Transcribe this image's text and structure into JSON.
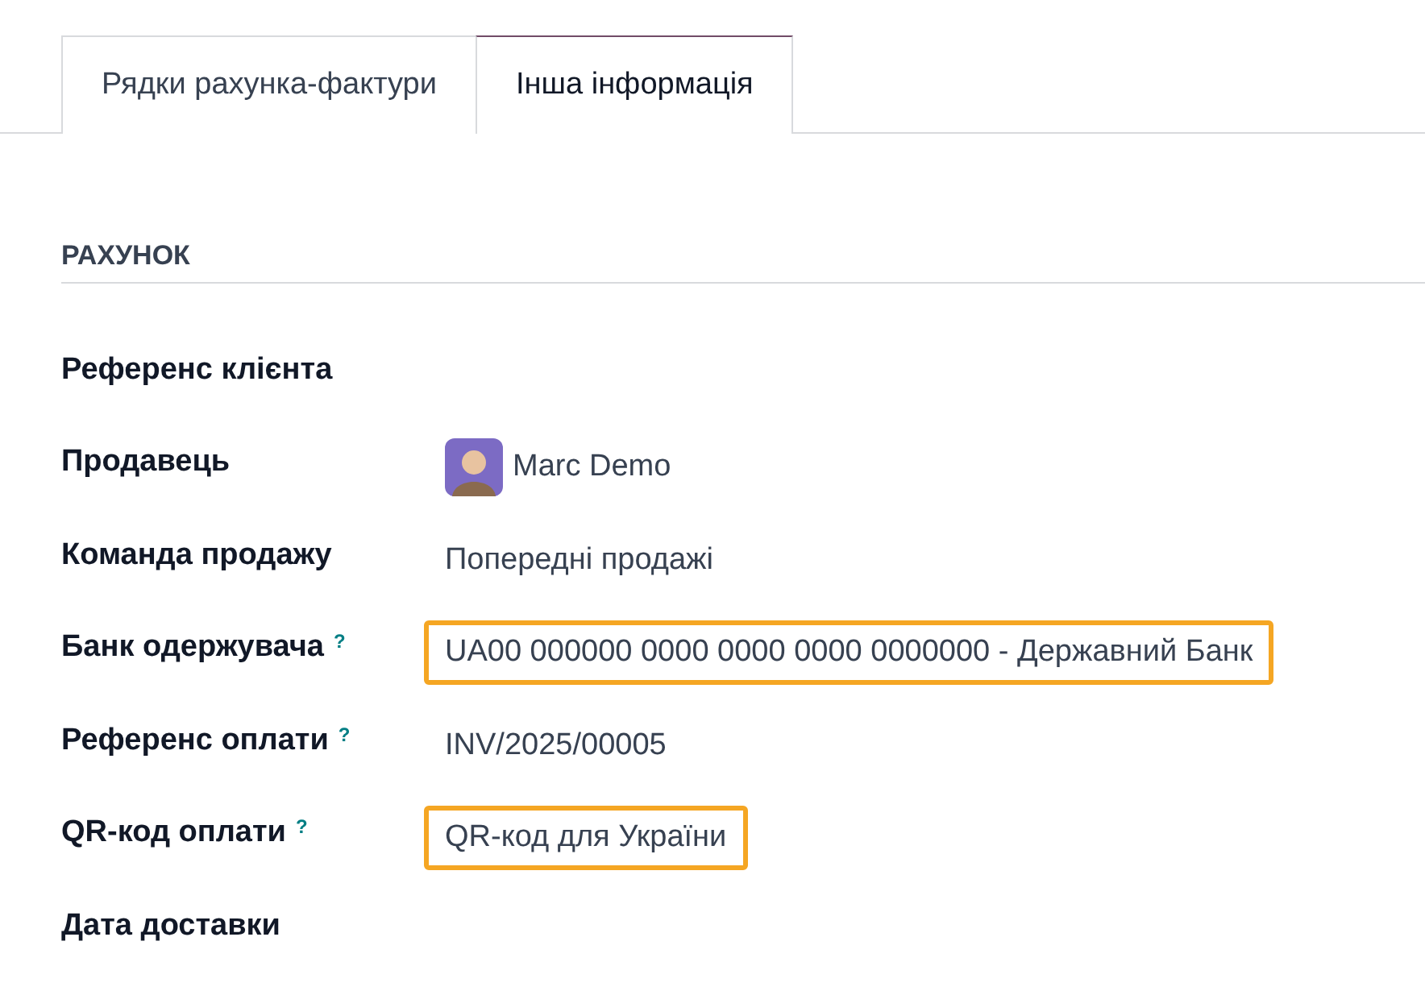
{
  "tabs": [
    {
      "label": "Рядки рахунка-фактури",
      "selected": false
    },
    {
      "label": "Інша інформація",
      "selected": true
    }
  ],
  "section": {
    "title": "РАХУНОК"
  },
  "fields": [
    {
      "kind": "empty",
      "label": "Референс клієнта"
    },
    {
      "kind": "user",
      "label": "Продавець",
      "value": "Marc Demo"
    },
    {
      "kind": "text",
      "label": "Команда продажу",
      "value": "Попередні продажі"
    },
    {
      "kind": "text",
      "label": "Банк одержувача",
      "help_mark": "?",
      "highlighted": true,
      "value": "UA00 000000 0000 0000 0000 0000000 - Державний Банк"
    },
    {
      "kind": "text",
      "label": "Референс оплати",
      "help_mark": "?",
      "value": "INV/2025/00005"
    },
    {
      "kind": "text",
      "label": "QR-код оплати",
      "help_mark": "?",
      "highlighted": true,
      "value": "QR-код для України"
    },
    {
      "kind": "empty",
      "label": "Дата доставки"
    }
  ]
}
